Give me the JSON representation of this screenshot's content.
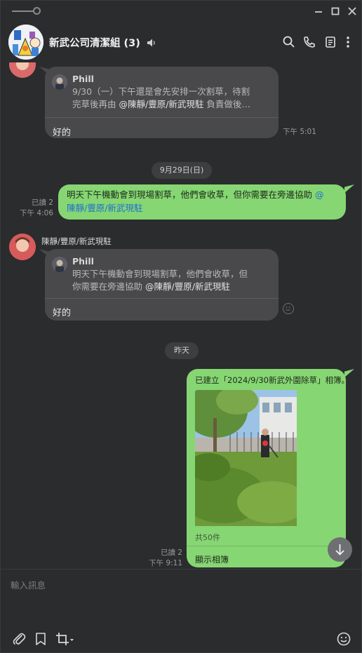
{
  "header": {
    "title": "新武公司清潔組 (3)"
  },
  "messages": {
    "reply1": {
      "quote_name": "Phill",
      "quote_line1": "9/30（一）下午還是會先安排一次割草，待割",
      "quote_line2_prefix": "完草後再由 ",
      "quote_line2_mention": "@陳靜/豐原/新武現駐",
      "quote_line2_suffix": " 負責做後…",
      "text": "好的",
      "time": "下午 5:01"
    },
    "date_sep1": "9月29日(日)",
    "out1": {
      "line1": "明天下午機動會到現場割草，他們會收草，但你需要在旁邊協助 ",
      "line1_mention": "@",
      "line2_mention": "陳靜/豐原/新武現駐",
      "read": "已讀 2",
      "time": "下午 4:06"
    },
    "in2": {
      "sender": "陳靜/豐原/新武現駐",
      "quote_name": "Phill",
      "quote_line1": "明天下午機動會到現場割草，他們會收草，但",
      "quote_line2_prefix": "你需要在旁邊協助 ",
      "quote_line2_mention": "@陳靜/豐原/新武現駐",
      "text": "好的"
    },
    "date_sep2": "昨天",
    "album": {
      "title": "已建立「2024/9/30新武外圍除草」相簿。",
      "count": "共50件",
      "button": "顯示相簿",
      "read": "已讀 2",
      "time": "下午 9:11"
    }
  },
  "input": {
    "placeholder": "輸入訊息"
  },
  "icons": {
    "attach": "paperclip-icon",
    "keep": "bookmark-icon",
    "capture": "crop-icon",
    "emoji": "smiley-icon"
  }
}
